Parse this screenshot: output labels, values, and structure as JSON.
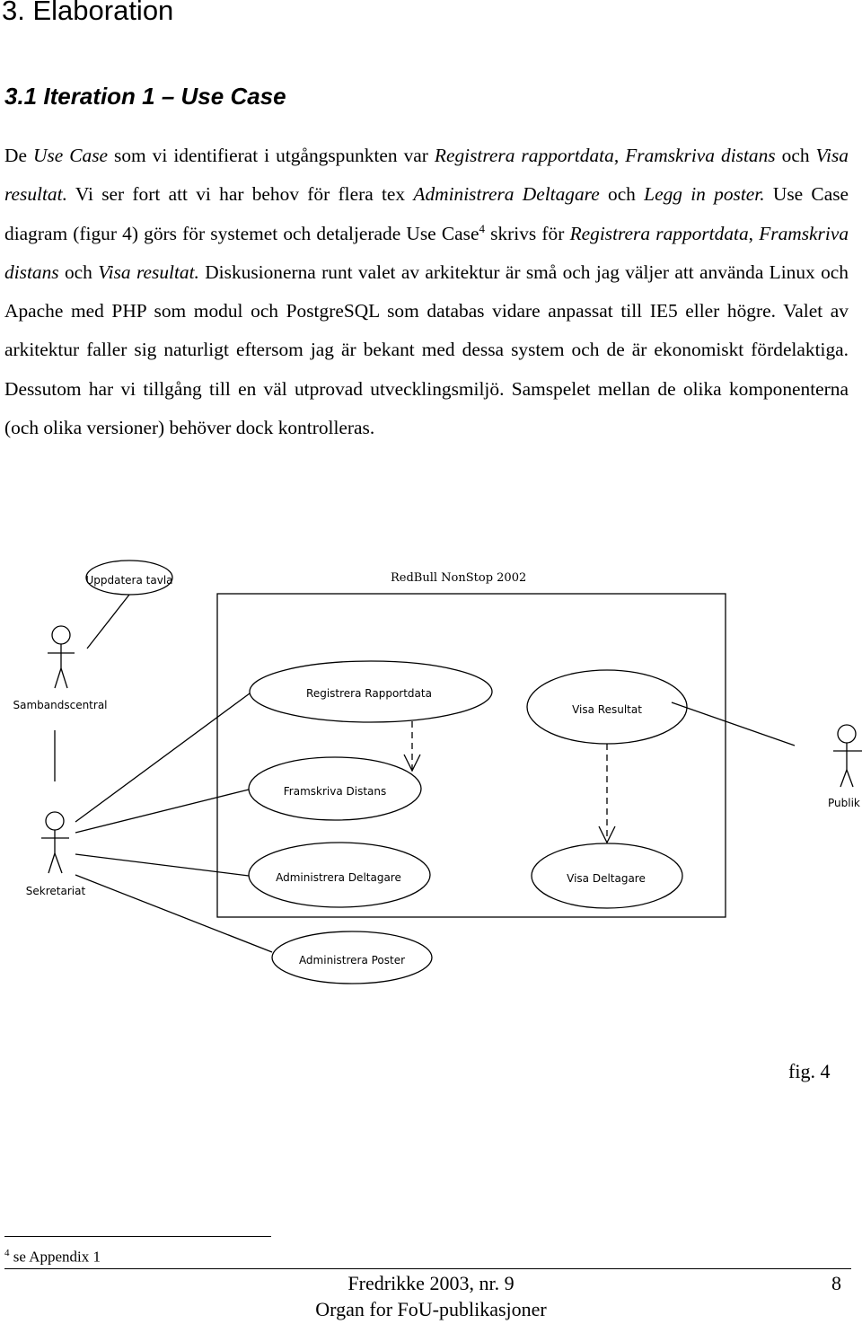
{
  "heading": "3. Elaboration",
  "subheading": "3.1 Iteration 1 – Use Case",
  "paragraph": {
    "t1": "De ",
    "i1": "Use Case",
    "t2": " som vi identifierat i utgångspunkten var ",
    "i2": "Registrera rapportdata",
    "t3": ", ",
    "i3": "Framskriva distans",
    "t4": " och ",
    "i4": "Visa resultat.",
    "t5": " Vi ser fort att vi har behov för flera tex ",
    "i5": "Administrera Deltagare",
    "t6": " och ",
    "i6": "Legg in poster.",
    "t7": "  Use Case diagram (figur 4) görs för systemet och detaljerade Use Case",
    "sup": "4",
    "t8": " skrivs för ",
    "i7": "Registrera rapportdata",
    "t9": ", ",
    "i8": "Framskriva distans",
    "t10": " och ",
    "i9": "Visa resultat.",
    "t11": " Diskusionerna runt valet av arkitektur är små och jag väljer att använda Linux och Apache med PHP som modul och PostgreSQL som databas vidare anpassat till IE5 eller högre. Valet av arkitektur faller sig naturligt eftersom jag är bekant med dessa system och de är ekonomiskt fördelaktiga. Dessutom har vi tillgång till en väl utprovad utvecklingsmiljö. Samspelet mellan de olika komponenterna (och olika versioner) behöver dock kontrolleras."
  },
  "diagram": {
    "system_title": "RedBull NonStop 2002",
    "actors": {
      "sambandscentral": "Sambandscentral",
      "sekretariat": "Sekretariat",
      "publik": "Publik"
    },
    "use_cases": {
      "uppdatera_tavla": "Uppdatera tavla",
      "registrera_rapportdata": "Registrera Rapportdata",
      "visa_resultat": "Visa Resultat",
      "framskriva_distans": "Framskriva Distans",
      "administrera_deltagare": "Administrera Deltagare",
      "visa_deltagare": "Visa Deltagare",
      "administrera_poster": "Administrera Poster"
    },
    "caption": "fig. 4"
  },
  "footnote": {
    "mark": "4",
    "text": " se Appendix  1"
  },
  "footer": {
    "line1": "Fredrikke 2003, nr. 9",
    "line2": "Organ for FoU-publikasjoner",
    "page_number": "8"
  }
}
